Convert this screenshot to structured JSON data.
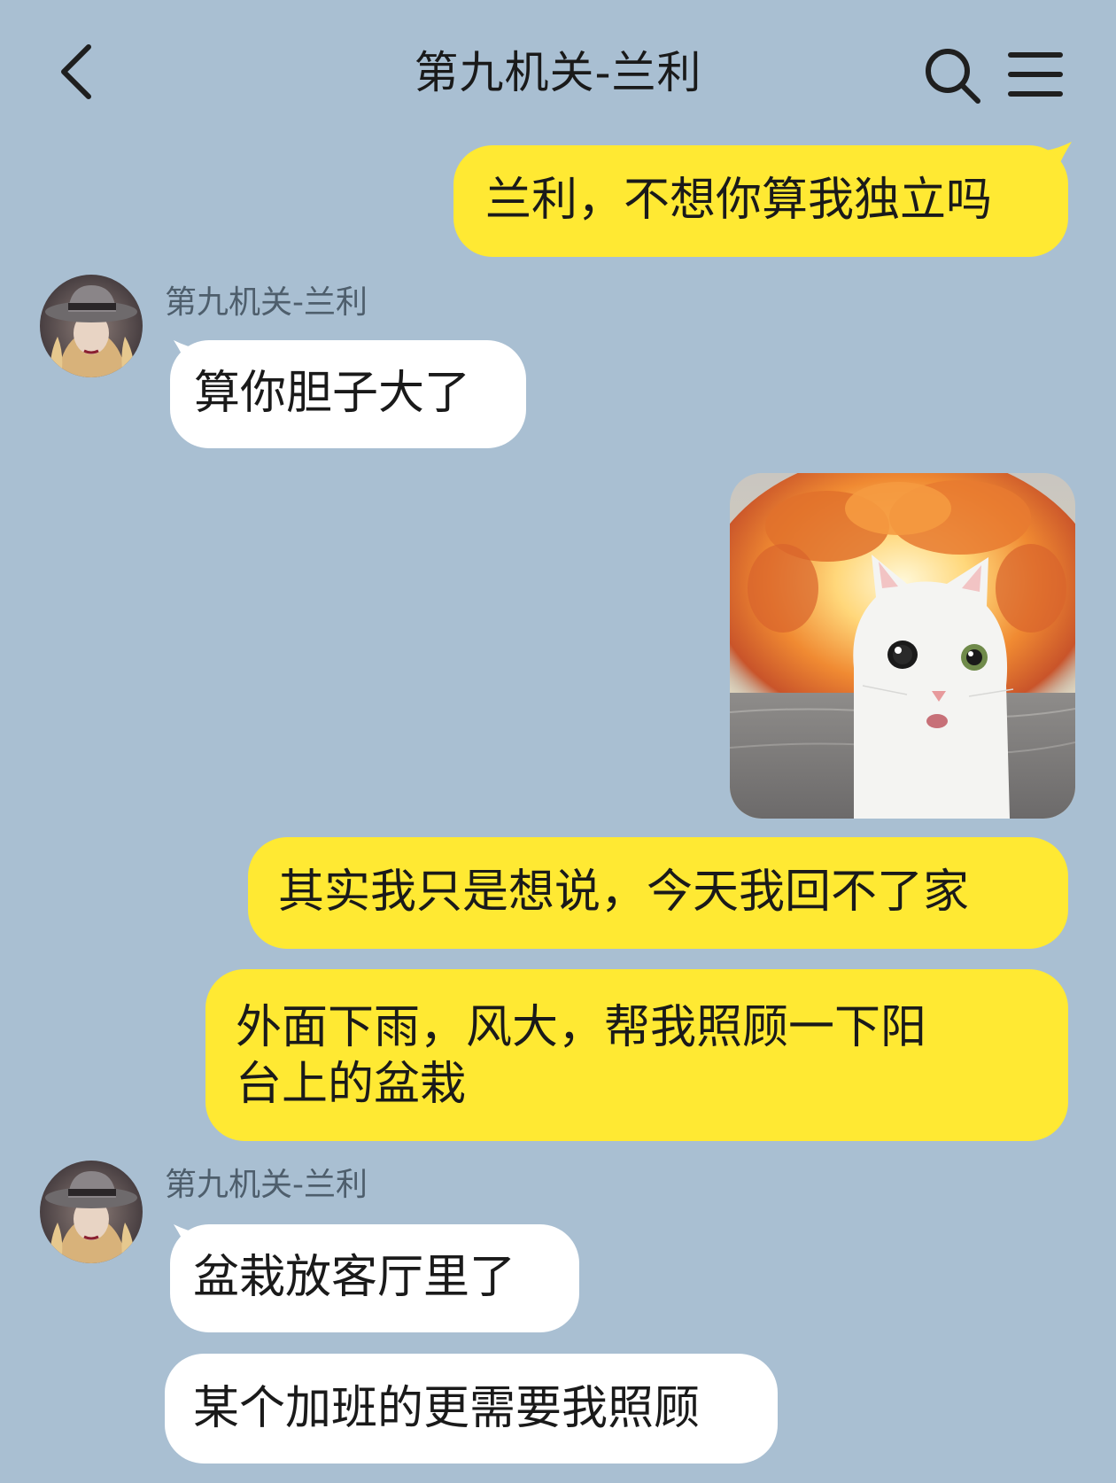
{
  "header": {
    "title": "第九机关-兰利",
    "back_icon": "chevron-left-icon",
    "search_icon": "search-icon",
    "menu_icon": "menu-icon"
  },
  "messages": [
    {
      "from": "me",
      "text": "兰利，不想你算我独立吗"
    },
    {
      "from": "them",
      "sender": "第九机关-兰利",
      "text": "算你胆子大了"
    },
    {
      "from": "me",
      "sticker": "explosion-cat-sticker"
    },
    {
      "from": "me",
      "text": "其实我只是想说，今天我回不了家"
    },
    {
      "from": "me",
      "lines": [
        "外面下雨，风大，帮我照顾一下阳",
        "台上的盆栽"
      ]
    },
    {
      "from": "them",
      "sender": "第九机关-兰利",
      "text": "盆栽放客厅里了"
    },
    {
      "from": "them",
      "text": "某个加班的更需要我照顾"
    }
  ],
  "colors": {
    "background": "#a9bfd2",
    "my_bubble": "#ffe933",
    "their_bubble": "#ffffff"
  }
}
